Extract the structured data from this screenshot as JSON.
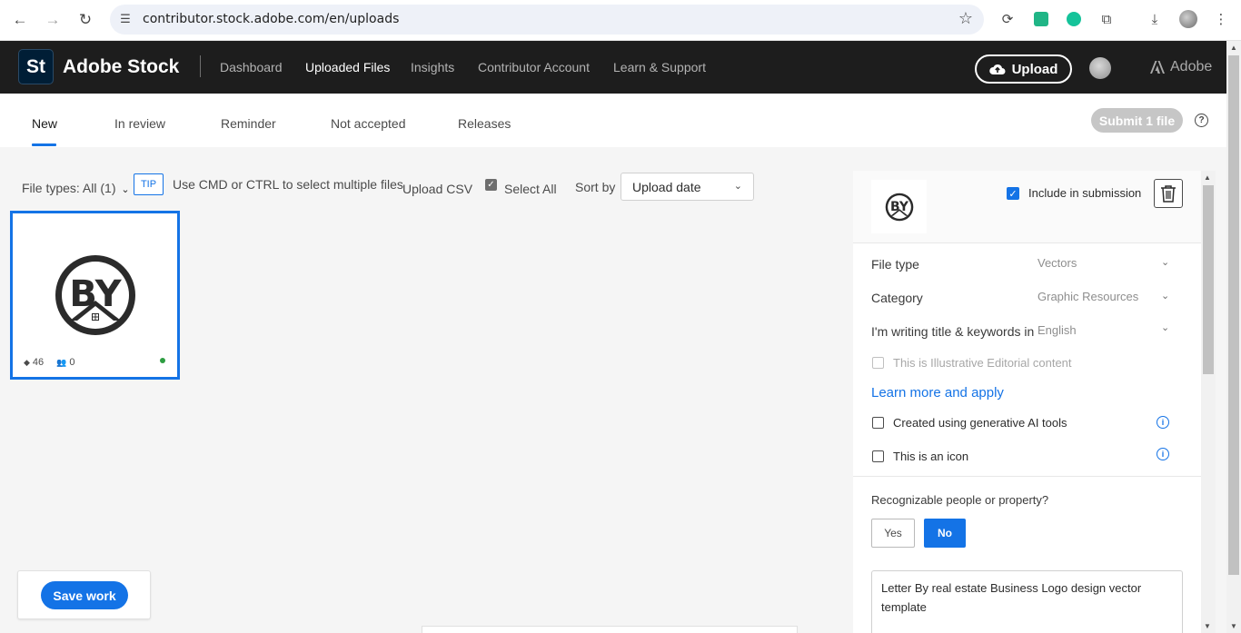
{
  "browser": {
    "url": "contributor.stock.adobe.com/en/uploads"
  },
  "header": {
    "logo_text": "St",
    "brand": "Adobe Stock",
    "nav": [
      "Dashboard",
      "Uploaded Files",
      "Insights",
      "Contributor Account",
      "Learn & Support"
    ],
    "active_nav": "Uploaded Files",
    "upload_label": "Upload",
    "adobe_label": "Adobe"
  },
  "tabs": {
    "items": [
      "New",
      "In review",
      "Reminder",
      "Not accepted",
      "Releases"
    ],
    "active": "New",
    "submit_label": "Submit 1 file",
    "help_glyph": "?"
  },
  "toolbar": {
    "file_types": "File types: All (1)",
    "tip_badge": "TIP",
    "tip_text": "Use CMD or CTRL to select multiple files",
    "upload_csv": "Upload CSV",
    "select_all": "Select All",
    "sort_by": "Sort by",
    "sort_value": "Upload date"
  },
  "thumbnail": {
    "keyword_count": "46",
    "people_count": "0",
    "status_color": "#2d9d41"
  },
  "save": {
    "label": "Save work"
  },
  "panel": {
    "include_label": "Include in submission",
    "fields": [
      {
        "label": "File type",
        "value": "Vectors"
      },
      {
        "label": "Category",
        "value": "Graphic Resources"
      },
      {
        "label": "I'm writing title & keywords in",
        "value": "English"
      }
    ],
    "editorial_label": "This is Illustrative Editorial content",
    "learn_more": "Learn more and apply",
    "genai_label": "Created using generative AI tools",
    "icon_label": "This is an icon",
    "recognizable_label": "Recognizable people or property?",
    "yes_label": "Yes",
    "no_label": "No",
    "title_value": "Letter By real estate Business Logo design vector template"
  },
  "colors": {
    "accent": "#1473e6",
    "header_bg": "#1d1d1d"
  }
}
